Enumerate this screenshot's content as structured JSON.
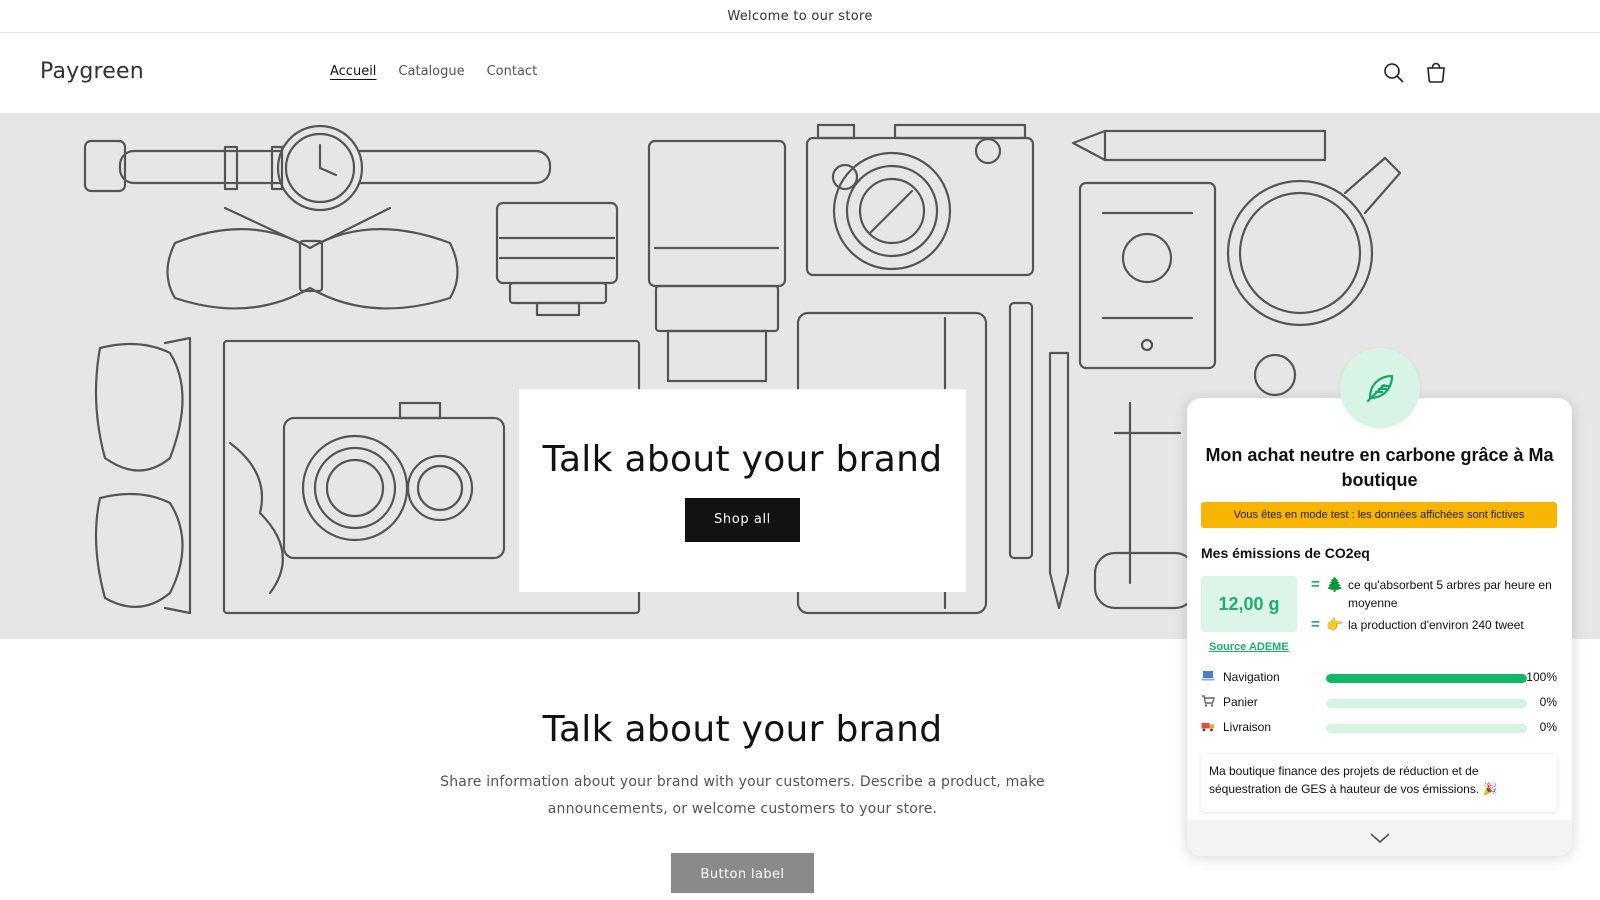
{
  "announcement": {
    "text": "Welcome to our store"
  },
  "header": {
    "logo": "Paygreen",
    "nav": [
      {
        "label": "Accueil",
        "active": true
      },
      {
        "label": "Catalogue",
        "active": false
      },
      {
        "label": "Contact",
        "active": false
      }
    ],
    "icons": {
      "search": "search-icon",
      "cart": "cart-icon"
    }
  },
  "hero": {
    "title": "Talk about your brand",
    "button_label": "Shop all",
    "background": "#e6e6e6"
  },
  "rich_text": {
    "title": "Talk about your brand",
    "body": "Share information about your brand with your customers. Describe a product, make announcements, or welcome customers to your store.",
    "button_label": "Button label"
  },
  "carbon_widget": {
    "icon": "leaf-icon",
    "title": "Mon achat neutre en carbone grâce à Ma boutique",
    "test_mode_notice": "Vous êtes en mode test : les données affichées sont fictives",
    "emissions_title": "Mes émissions de CO2eq",
    "value": "12,00 g",
    "source_label": "Source ADEME",
    "equivalents": [
      {
        "symbol": "=",
        "icon": "tree-icon",
        "emoji": "🌲",
        "text": "ce qu'absorbent 5 arbres par heure en moyenne"
      },
      {
        "symbol": "=",
        "icon": "pointing-hand-icon",
        "emoji": "👉",
        "text": "la production d'environ 240 tweet"
      }
    ],
    "breakdown": [
      {
        "label": "Navigation",
        "icon": "laptop-icon",
        "percent_label": "100%",
        "percent": 100
      },
      {
        "label": "Panier",
        "icon": "cart-icon",
        "percent_label": "0%",
        "percent": 0
      },
      {
        "label": "Livraison",
        "icon": "truck-icon",
        "percent_label": "0%",
        "percent": 0
      }
    ],
    "finance_text": "Ma boutique finance des projets de réduction et de séquestration de GES à hauteur de vos émissions. 🎉",
    "collapse_icon": "chevron-down-icon",
    "colors": {
      "accent": "#12b86a",
      "accent_light": "#d6f3e4",
      "warning": "#f7b500"
    }
  }
}
